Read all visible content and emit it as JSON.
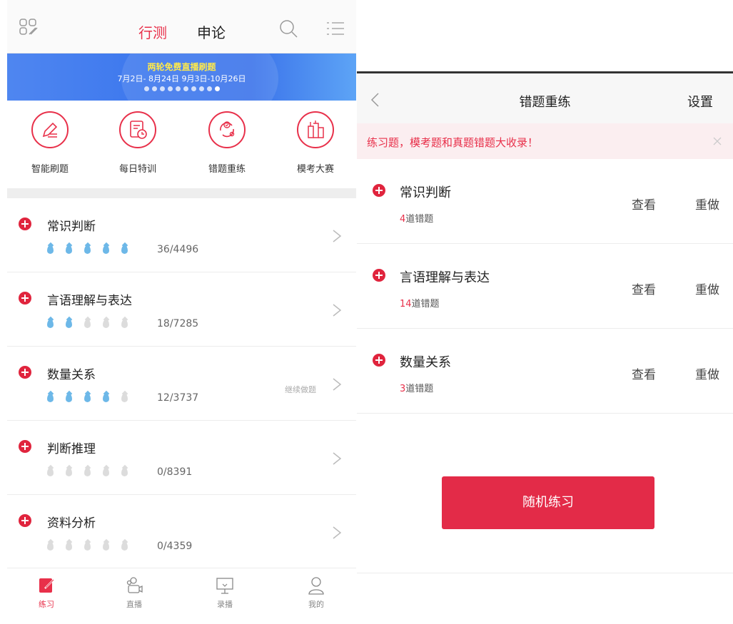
{
  "left": {
    "header": {
      "tab_xingce": "行测",
      "tab_shenlun": "申论"
    },
    "banner": {
      "title": "两轮免费直播刷题",
      "dates": "7月2日- 8月24日   9月3日-10月26日",
      "dots": 10,
      "active_dot": 9
    },
    "quick_actions": [
      {
        "label": "智能刷题",
        "icon": "pen-icon"
      },
      {
        "label": "每日特训",
        "icon": "calendar-clock-icon"
      },
      {
        "label": "错题重练",
        "icon": "refresh-cycle-icon"
      },
      {
        "label": "模考大赛",
        "icon": "exam-icon"
      }
    ],
    "categories": [
      {
        "name": "常识判断",
        "progress": "36/4496",
        "drops_filled": 5,
        "continue": ""
      },
      {
        "name": "言语理解与表达",
        "progress": "18/7285",
        "drops_filled": 2,
        "continue": ""
      },
      {
        "name": "数量关系",
        "progress": "12/3737",
        "drops_filled": 4,
        "continue": "继续做题"
      },
      {
        "name": "判断推理",
        "progress": "0/8391",
        "drops_filled": 0,
        "continue": ""
      },
      {
        "name": "资料分析",
        "progress": "0/4359",
        "drops_filled": 0,
        "continue": ""
      }
    ],
    "bottom_nav": [
      {
        "label": "练习",
        "active": true
      },
      {
        "label": "直播",
        "active": false
      },
      {
        "label": "录播",
        "active": false
      },
      {
        "label": "我的",
        "active": false
      }
    ]
  },
  "right": {
    "header": {
      "title": "错题重练",
      "settings": "设置"
    },
    "notice": "练习题，模考题和真题错题大收录！",
    "items": [
      {
        "name": "常识判断",
        "count": "4",
        "suffix": "道错题",
        "view": "查看",
        "redo": "重做"
      },
      {
        "name": "言语理解与表达",
        "count": "14",
        "suffix": "道错题",
        "view": "查看",
        "redo": "重做"
      },
      {
        "name": "数量关系",
        "count": "3",
        "suffix": "道错题",
        "view": "查看",
        "redo": "重做"
      }
    ],
    "random_button": "随机练习"
  },
  "colors": {
    "accent": "#e8304a",
    "drop_on": "#6db8e8",
    "drop_off": "#dcdcdc",
    "banner_blue": "#3d78ee"
  }
}
